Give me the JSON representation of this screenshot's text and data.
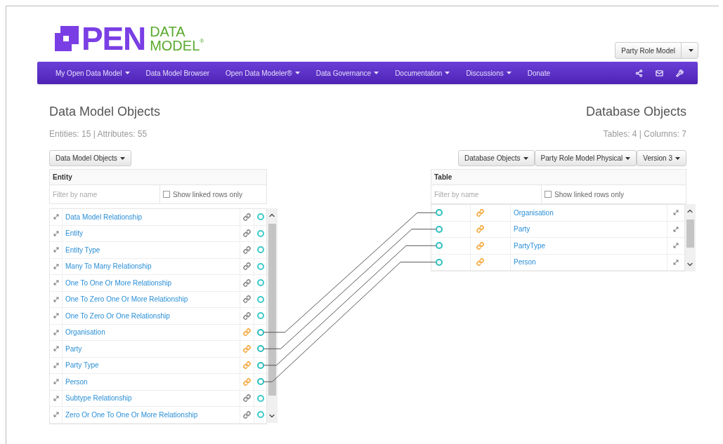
{
  "logo": {
    "word": "PEN",
    "line_1": "DATA",
    "line_2": "MODEL",
    "mark": "®"
  },
  "model_selector": {
    "label": "Party Role Model"
  },
  "nav": {
    "items": [
      {
        "label": "My Open Data Model",
        "dropdown": true
      },
      {
        "label": "Data Model Browser",
        "dropdown": false
      },
      {
        "label": "Open Data Modeler®",
        "dropdown": true
      },
      {
        "label": "Data Governance",
        "dropdown": true
      },
      {
        "label": "Documentation",
        "dropdown": true
      },
      {
        "label": "Discussions",
        "dropdown": true
      },
      {
        "label": "Donate",
        "dropdown": false
      }
    ]
  },
  "left_panel": {
    "title": "Data Model Objects",
    "summary": "Entities: 15 | Attributes: 55",
    "dropdowns": [
      "Data Model Objects"
    ],
    "table": {
      "header": "Entity",
      "filter": {
        "placeholder": "Filter by name"
      },
      "linked_only": {
        "label": "Show linked rows only",
        "checked": false
      },
      "rows": [
        {
          "name": "Data Model Relationship",
          "linked": false
        },
        {
          "name": "Entity",
          "linked": false
        },
        {
          "name": "Entity Type",
          "linked": false
        },
        {
          "name": "Many To Many Relationship",
          "linked": false
        },
        {
          "name": "One To One Or More Relationship",
          "linked": false
        },
        {
          "name": "One To Zero One Or More Relationship",
          "linked": false
        },
        {
          "name": "One To Zero Or One Relationship",
          "linked": false
        },
        {
          "name": "Organisation",
          "linked": true
        },
        {
          "name": "Party",
          "linked": true
        },
        {
          "name": "Party Type",
          "linked": true
        },
        {
          "name": "Person",
          "linked": true
        },
        {
          "name": "Subtype Relationship",
          "linked": false
        },
        {
          "name": "Zero Or One To One Or More Relationship",
          "linked": false
        }
      ]
    }
  },
  "right_panel": {
    "title": "Database Objects",
    "summary": "Tables: 4 | Columns: 7",
    "dropdowns": [
      "Database Objects",
      "Party Role Model Physical",
      "Version 3"
    ],
    "table": {
      "header": "Table",
      "filter": {
        "placeholder": "Filter by name"
      },
      "linked_only": {
        "label": "Show linked rows only",
        "checked": false
      },
      "rows": [
        {
          "name": "Organisation",
          "linked": true
        },
        {
          "name": "Party",
          "linked": true
        },
        {
          "name": "PartyType",
          "linked": true
        },
        {
          "name": "Person",
          "linked": true
        }
      ]
    }
  }
}
